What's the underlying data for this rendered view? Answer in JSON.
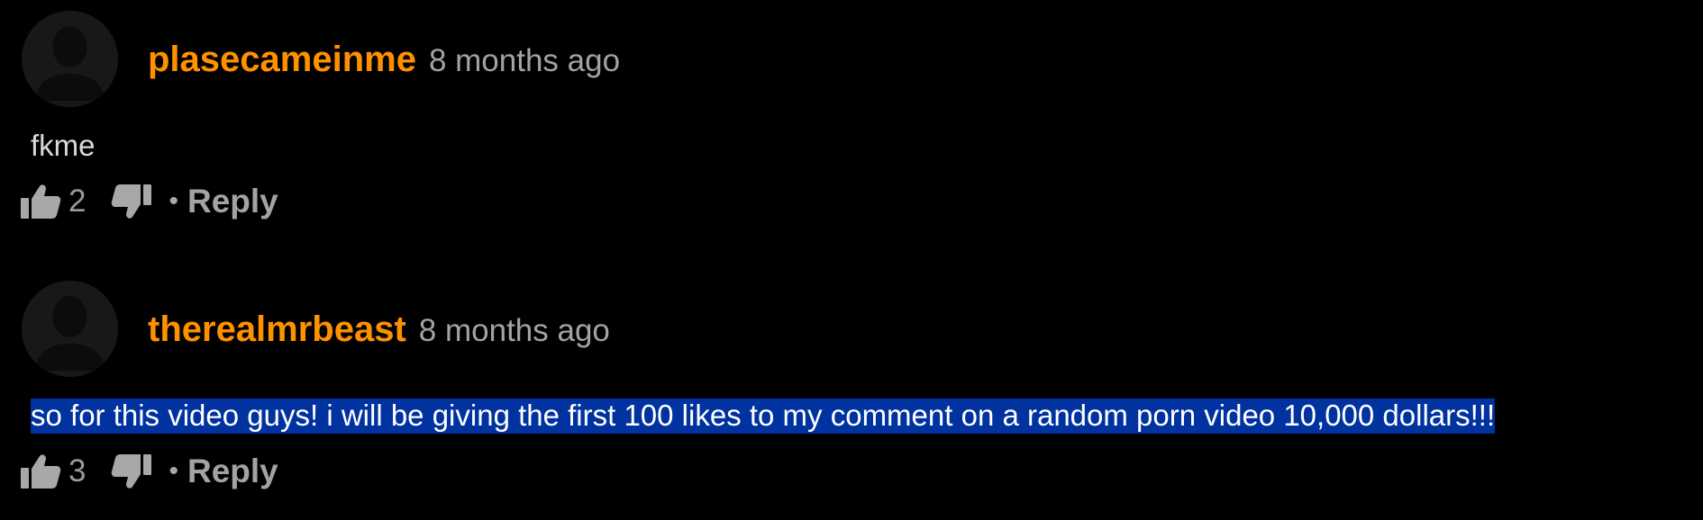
{
  "comments": [
    {
      "username": "plasecameinme",
      "timestamp": "8 months ago",
      "text": "fkme",
      "likes": "2",
      "reply_label": "Reply",
      "bullet": "•",
      "text_selected": false
    },
    {
      "username": "therealmrbeast",
      "timestamp": "8 months ago",
      "text": "so for this video guys! i will be giving the first 100 likes to my comment on a random porn video 10,000 dollars!!!",
      "likes": "3",
      "reply_label": "Reply",
      "bullet": "•",
      "text_selected": true
    }
  ],
  "icons": {
    "avatar": "default-user-avatar-icon",
    "like": "thumbs-up-icon",
    "dislike": "thumbs-down-icon"
  },
  "colors": {
    "background": "#000000",
    "username": "#ff9000",
    "muted_text": "#a3a3a3",
    "selection": "#0032a0"
  }
}
